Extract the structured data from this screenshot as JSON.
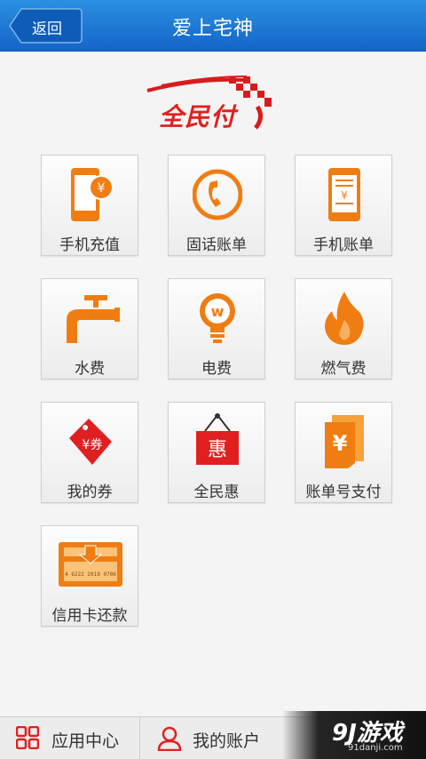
{
  "header": {
    "back_label": "返回",
    "title": "爱上宅神"
  },
  "logo": {
    "text": "全民付"
  },
  "services": [
    {
      "label": "手机充值",
      "icon": "phone-recharge-icon"
    },
    {
      "label": "固话账单",
      "icon": "landline-phone-icon"
    },
    {
      "label": "手机账单",
      "icon": "phone-bill-icon"
    },
    {
      "label": "水费",
      "icon": "water-faucet-icon"
    },
    {
      "label": "电费",
      "icon": "light-bulb-icon"
    },
    {
      "label": "燃气费",
      "icon": "gas-flame-icon"
    },
    {
      "label": "我的券",
      "icon": "coupon-tag-icon",
      "glyph": "¥券"
    },
    {
      "label": "全民惠",
      "icon": "discount-sign-icon",
      "glyph": "惠"
    },
    {
      "label": "账单号支付",
      "icon": "bill-number-icon"
    },
    {
      "label": "信用卡还款",
      "icon": "credit-card-icon",
      "card_number": "4 6222 2019 0706"
    }
  ],
  "bottom_nav": {
    "apps_label": "应用中心",
    "account_label": "我的账户"
  },
  "watermark": {
    "main": "9J游戏",
    "sub": "91danji.com"
  },
  "colors": {
    "header": "#1a78d6",
    "accent_orange": "#f07d12",
    "brand_red": "#e02020"
  }
}
